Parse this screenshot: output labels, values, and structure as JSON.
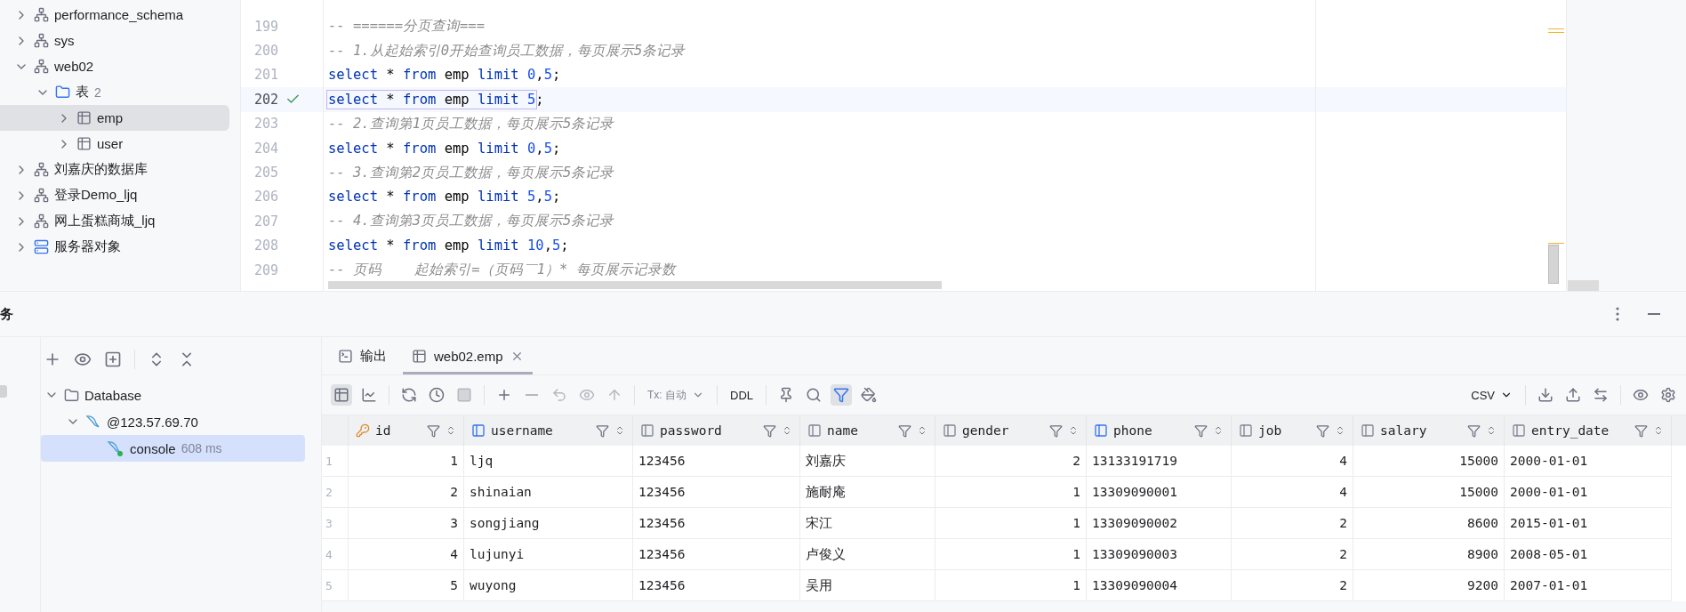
{
  "db_tree": [
    {
      "kind": "schema",
      "name": "performance_schema",
      "expanded": false,
      "selected": false
    },
    {
      "kind": "schema",
      "name": "sys",
      "expanded": false,
      "selected": false
    },
    {
      "kind": "schema",
      "name": "web02",
      "expanded": true,
      "selected": false,
      "children": [
        {
          "kind": "folder",
          "name": "表",
          "count": "2",
          "expanded": true,
          "selected": false,
          "children": [
            {
              "kind": "table",
              "name": "emp",
              "expanded": false,
              "selected": true
            },
            {
              "kind": "table",
              "name": "user",
              "expanded": false,
              "selected": false
            }
          ]
        }
      ]
    },
    {
      "kind": "schema",
      "name": "刘嘉庆的数据库",
      "expanded": false,
      "selected": false
    },
    {
      "kind": "schema",
      "name": "登录Demo_ljq",
      "expanded": false,
      "selected": false
    },
    {
      "kind": "schema",
      "name": "网上蛋糕商城_ljq",
      "expanded": false,
      "selected": false
    },
    {
      "kind": "server",
      "name": "服务器对象",
      "expanded": false,
      "selected": false
    }
  ],
  "editor": {
    "lines": [
      {
        "number": "199",
        "selected": false,
        "executed": false,
        "tokens": [
          {
            "kind": "comment",
            "text": "-- ======分页查询==="
          }
        ]
      },
      {
        "number": "200",
        "selected": false,
        "executed": false,
        "tokens": [
          {
            "kind": "comment",
            "text": "-- 1.从起始索引0开始查询员工数据，每页展示5条记录"
          }
        ]
      },
      {
        "number": "201",
        "selected": false,
        "executed": false,
        "tokens": [
          {
            "kind": "keyword",
            "text": "select"
          },
          {
            "kind": "plain",
            "text": " * "
          },
          {
            "kind": "keyword",
            "text": "from"
          },
          {
            "kind": "plain",
            "text": " emp "
          },
          {
            "kind": "keyword",
            "text": "limit"
          },
          {
            "kind": "number",
            "text": " 0"
          },
          {
            "kind": "plain",
            "text": ","
          },
          {
            "kind": "number",
            "text": "5"
          },
          {
            "kind": "plain",
            "text": ";"
          }
        ]
      },
      {
        "number": "202",
        "selected": true,
        "executed": true,
        "tokens": [
          {
            "kind": "keyword",
            "text": "select"
          },
          {
            "kind": "plain",
            "text": " * "
          },
          {
            "kind": "keyword",
            "text": "from"
          },
          {
            "kind": "plain",
            "text": " emp "
          },
          {
            "kind": "keyword",
            "text": "limit"
          },
          {
            "kind": "number",
            "text": " 5"
          }
        ],
        "tail": ";"
      },
      {
        "number": "203",
        "selected": false,
        "executed": false,
        "tokens": [
          {
            "kind": "comment",
            "text": "-- 2.查询第1页员工数据，每页展示5条记录"
          }
        ]
      },
      {
        "number": "204",
        "selected": false,
        "executed": false,
        "tokens": [
          {
            "kind": "keyword",
            "text": "select"
          },
          {
            "kind": "plain",
            "text": " * "
          },
          {
            "kind": "keyword",
            "text": "from"
          },
          {
            "kind": "plain",
            "text": " emp "
          },
          {
            "kind": "keyword",
            "text": "limit"
          },
          {
            "kind": "number",
            "text": " 0"
          },
          {
            "kind": "plain",
            "text": ","
          },
          {
            "kind": "number",
            "text": "5"
          },
          {
            "kind": "plain",
            "text": ";"
          }
        ]
      },
      {
        "number": "205",
        "selected": false,
        "executed": false,
        "tokens": [
          {
            "kind": "comment",
            "text": "-- 3.查询第2页员工数据，每页展示5条记录"
          }
        ]
      },
      {
        "number": "206",
        "selected": false,
        "executed": false,
        "tokens": [
          {
            "kind": "keyword",
            "text": "select"
          },
          {
            "kind": "plain",
            "text": " * "
          },
          {
            "kind": "keyword",
            "text": "from"
          },
          {
            "kind": "plain",
            "text": " emp "
          },
          {
            "kind": "keyword",
            "text": "limit"
          },
          {
            "kind": "number",
            "text": " 5"
          },
          {
            "kind": "plain",
            "text": ","
          },
          {
            "kind": "number",
            "text": "5"
          },
          {
            "kind": "plain",
            "text": ";"
          }
        ]
      },
      {
        "number": "207",
        "selected": false,
        "executed": false,
        "tokens": [
          {
            "kind": "comment",
            "text": "-- 4.查询第3页员工数据，每页展示5条记录"
          }
        ]
      },
      {
        "number": "208",
        "selected": false,
        "executed": false,
        "tokens": [
          {
            "kind": "keyword",
            "text": "select"
          },
          {
            "kind": "plain",
            "text": " * "
          },
          {
            "kind": "keyword",
            "text": "from"
          },
          {
            "kind": "plain",
            "text": " emp "
          },
          {
            "kind": "keyword",
            "text": "limit"
          },
          {
            "kind": "number",
            "text": " 10"
          },
          {
            "kind": "plain",
            "text": ","
          },
          {
            "kind": "number",
            "text": "5"
          },
          {
            "kind": "plain",
            "text": ";"
          }
        ]
      },
      {
        "number": "209",
        "selected": false,
        "executed": false,
        "tokens": [
          {
            "kind": "comment",
            "text": "-- 页码    起始索引=（页码￣1）* 每页展示记录数"
          }
        ]
      }
    ]
  },
  "services": {
    "title": "务",
    "tree": [
      {
        "kind": "folder",
        "name": "Database",
        "expanded": true,
        "selected": false,
        "children": [
          {
            "kind": "connection",
            "name": "@123.57.69.70",
            "expanded": true,
            "selected": false,
            "children": [
              {
                "kind": "console",
                "name": "console",
                "time": "608 ms",
                "selected": true
              }
            ]
          }
        ]
      }
    ]
  },
  "results": {
    "tabs": [
      {
        "kind": "console",
        "label": "输出",
        "selected": false,
        "closable": false
      },
      {
        "kind": "table",
        "label": "web02.emp",
        "selected": true,
        "closable": true
      }
    ],
    "toolbar": [
      {
        "kind": "grid",
        "selected": true,
        "disabled": false
      },
      {
        "kind": "chart",
        "selected": false,
        "disabled": false
      },
      {
        "kind": "sep"
      },
      {
        "kind": "refresh",
        "selected": false,
        "disabled": false
      },
      {
        "kind": "history",
        "selected": false,
        "disabled": false
      },
      {
        "kind": "stop",
        "selected": false,
        "disabled": true
      },
      {
        "kind": "sep"
      },
      {
        "kind": "add",
        "selected": false,
        "disabled": false
      },
      {
        "kind": "remove",
        "selected": false,
        "disabled": true
      },
      {
        "kind": "undo",
        "selected": false,
        "disabled": true
      },
      {
        "kind": "preview",
        "selected": false,
        "disabled": true
      },
      {
        "kind": "submit",
        "selected": false,
        "disabled": true
      },
      {
        "kind": "sep"
      },
      {
        "kind": "tx",
        "label": "Tx: 自动"
      },
      {
        "kind": "sep"
      },
      {
        "kind": "text",
        "label": "DDL"
      },
      {
        "kind": "sep"
      },
      {
        "kind": "pin",
        "selected": false,
        "disabled": false
      },
      {
        "kind": "search",
        "selected": false,
        "disabled": false
      },
      {
        "kind": "filter",
        "selected": true,
        "disabled": false
      },
      {
        "kind": "paint",
        "selected": false,
        "disabled": false
      },
      {
        "kind": "spacer"
      },
      {
        "kind": "format",
        "label": "CSV"
      },
      {
        "kind": "sep"
      },
      {
        "kind": "download",
        "selected": false,
        "disabled": false
      },
      {
        "kind": "upload",
        "selected": false,
        "disabled": false
      },
      {
        "kind": "compare",
        "selected": false,
        "disabled": false
      },
      {
        "kind": "sep"
      },
      {
        "kind": "eye",
        "selected": false,
        "disabled": false
      },
      {
        "kind": "settings",
        "selected": false,
        "disabled": false
      }
    ],
    "table": {
      "columns": [
        {
          "name": "id",
          "kind": "primary_key",
          "numeric": true
        },
        {
          "name": "username",
          "kind": "indexed",
          "numeric": false
        },
        {
          "name": "password",
          "kind": "plain",
          "numeric": false
        },
        {
          "name": "name",
          "kind": "plain",
          "numeric": false
        },
        {
          "name": "gender",
          "kind": "plain",
          "numeric": true
        },
        {
          "name": "phone",
          "kind": "indexed",
          "numeric": false
        },
        {
          "name": "job",
          "kind": "plain",
          "numeric": true
        },
        {
          "name": "salary",
          "kind": "plain",
          "numeric": true
        },
        {
          "name": "entry_date",
          "kind": "plain",
          "numeric": false
        }
      ],
      "rows": [
        {
          "number": "1",
          "cells": [
            "1",
            "ljq",
            "123456",
            "刘嘉庆",
            "2",
            "13133191719",
            "4",
            "15000",
            "2000-01-01"
          ]
        },
        {
          "number": "2",
          "cells": [
            "2",
            "shinaian",
            "123456",
            "施耐庵",
            "1",
            "13309090001",
            "4",
            "15000",
            "2000-01-01"
          ]
        },
        {
          "number": "3",
          "cells": [
            "3",
            "songjiang",
            "123456",
            "宋江",
            "1",
            "13309090002",
            "2",
            "8600",
            "2015-01-01"
          ]
        },
        {
          "number": "4",
          "cells": [
            "4",
            "lujunyi",
            "123456",
            "卢俊义",
            "1",
            "13309090003",
            "2",
            "8900",
            "2008-05-01"
          ]
        },
        {
          "number": "5",
          "cells": [
            "5",
            "wuyong",
            "123456",
            "吴用",
            "1",
            "13309090004",
            "2",
            "9200",
            "2007-01-01"
          ]
        }
      ]
    }
  }
}
